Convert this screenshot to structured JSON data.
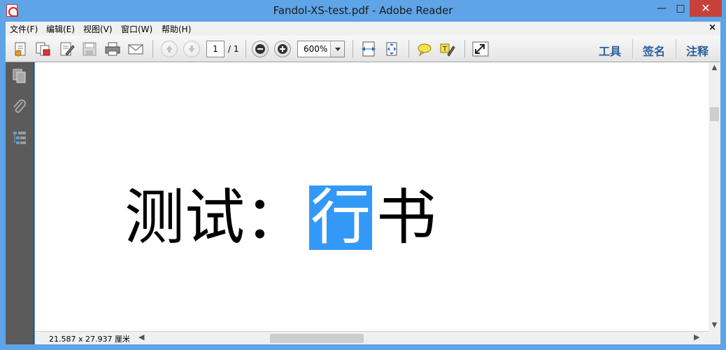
{
  "window": {
    "title": "Fandol-XS-test.pdf - Adobe Reader",
    "controls": {
      "minimize": "—",
      "maximize": "□",
      "close": "✕"
    }
  },
  "menu": {
    "items": [
      "文件(F)",
      "编辑(E)",
      "视图(V)",
      "窗口(W)",
      "帮助(H)"
    ],
    "close_glyph": "×"
  },
  "toolbar": {
    "page_current": "1",
    "page_total": "/ 1",
    "zoom": "600%",
    "links": [
      "工具",
      "签名",
      "注释"
    ]
  },
  "document": {
    "label": "测试：",
    "selected_char": "行",
    "rest": "书"
  },
  "status": {
    "page_size": "21.587 x 27.937 厘米"
  },
  "icons": {
    "nav": [
      "pages-icon",
      "attachment-icon",
      "layers-icon"
    ]
  },
  "colors": {
    "titlebar": "#5fa4e6",
    "selection": "#3399f6",
    "close_button": "#c7413a",
    "link_text": "#2d5f9c",
    "nav_pane": "#5b5b5b"
  }
}
